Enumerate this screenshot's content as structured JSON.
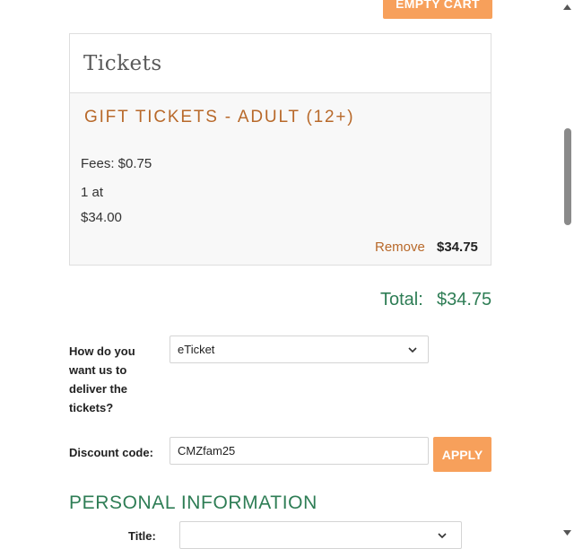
{
  "cart": {
    "empty_cart_label": "EMPTY CART"
  },
  "tickets": {
    "heading": "Tickets",
    "item_name": "GIFT TICKETS - ADULT (12+)",
    "fees": "Fees: $0.75",
    "quantity": "1 at",
    "unit_price": "$34.00",
    "remove_label": "Remove",
    "line_total": "$34.75"
  },
  "summary": {
    "total_label": "Total:",
    "total_value": "$34.75"
  },
  "delivery": {
    "label": "How do you want us to deliver the tickets?",
    "selected": "eTicket"
  },
  "discount": {
    "label": "Discount code:",
    "value": "CMZfam25",
    "apply_label": "APPLY"
  },
  "personal": {
    "section_title": "PERSONAL INFORMATION",
    "title_label": "Title:",
    "title_value": ""
  },
  "colors": {
    "accent_orange": "#f7a05b",
    "item_brown": "#b8692a",
    "total_green": "#2e7d55"
  },
  "icons": [
    "chevron-down-icon",
    "scroll-up-arrow-icon",
    "scroll-down-arrow-icon"
  ]
}
